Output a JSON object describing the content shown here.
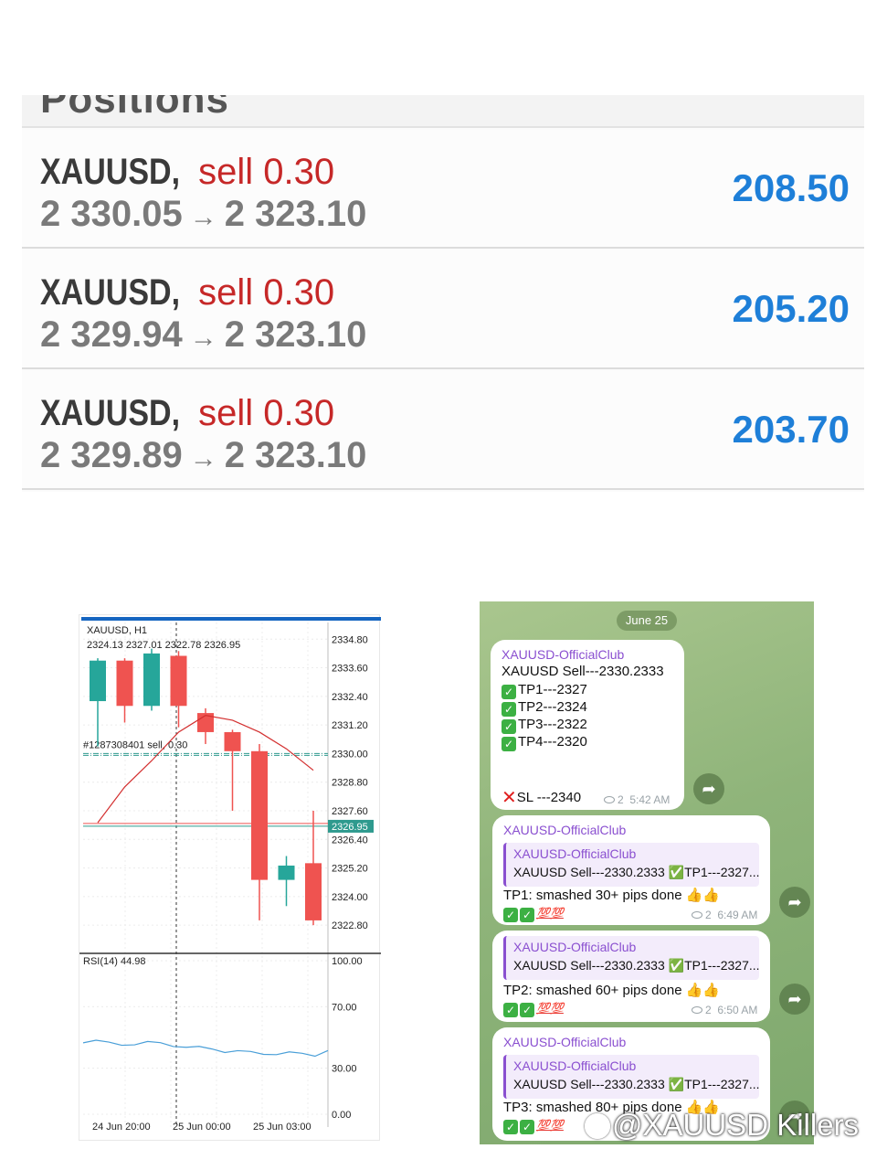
{
  "positions": {
    "header_label": "Positions",
    "rows": [
      {
        "symbol": "XAUUSD,",
        "side": "sell 0.30",
        "open_price": "2 330.05",
        "arrow": "→",
        "current_price": "2 323.10",
        "profit": "208.50"
      },
      {
        "symbol": "XAUUSD,",
        "side": "sell 0.30",
        "open_price": "2 329.94",
        "arrow": "→",
        "current_price": "2 323.10",
        "profit": "205.20"
      },
      {
        "symbol": "XAUUSD,",
        "side": "sell 0.30",
        "open_price": "2 329.89",
        "arrow": "→",
        "current_price": "2 323.10",
        "profit": "203.70"
      }
    ],
    "colors": {
      "side": "#c62828",
      "profit": "#1e7fd8",
      "symbol": "#3a3a3a"
    }
  },
  "chart_data": {
    "type": "candlestick",
    "title": "XAUUSD, H1",
    "ohlc_label": "2324.13 2327.01 2322.78 2326.95",
    "order_label": "#1287308401 sell, 0.30",
    "current_price_label": "2326.95",
    "ylim": [
      2322.0,
      2335.5
    ],
    "price_ticks": [
      "2334.80",
      "2333.60",
      "2332.40",
      "2331.20",
      "2330.00",
      "2328.80",
      "2327.60",
      "2326.40",
      "2325.20",
      "2324.00",
      "2322.80"
    ],
    "candles": [
      {
        "o": 2332.2,
        "h": 2334.0,
        "l": 2330.3,
        "c": 2333.9
      },
      {
        "o": 2333.9,
        "h": 2334.0,
        "l": 2331.3,
        "c": 2332.0
      },
      {
        "o": 2332.0,
        "h": 2334.4,
        "l": 2331.8,
        "c": 2334.2
      },
      {
        "o": 2334.1,
        "h": 2334.3,
        "l": 2331.1,
        "c": 2332.0
      },
      {
        "o": 2331.7,
        "h": 2331.9,
        "l": 2330.4,
        "c": 2330.9
      },
      {
        "o": 2330.9,
        "h": 2331.0,
        "l": 2327.6,
        "c": 2330.1
      },
      {
        "o": 2330.1,
        "h": 2330.4,
        "l": 2323.0,
        "c": 2324.7
      },
      {
        "o": 2324.7,
        "h": 2325.7,
        "l": 2323.6,
        "c": 2325.3
      },
      {
        "o": 2325.4,
        "h": 2327.6,
        "l": 2322.8,
        "c": 2323.0
      }
    ],
    "ma": [
      2327.1,
      2328.6,
      2329.7,
      2330.9,
      2331.6,
      2331.4,
      2330.9,
      2330.2,
      2329.3
    ],
    "order_price": 2330.0,
    "current_price": 2326.95,
    "rsi_label": "RSI(14) 44.98",
    "rsi_ticks": [
      "100.00",
      "70.00",
      "30.00",
      "0.00"
    ],
    "rsi_ylim": [
      0,
      100
    ],
    "rsi": [
      46.5,
      48.2,
      47.0,
      44.9,
      45.2,
      47.4,
      46.6,
      44.1,
      43.6,
      44.2,
      42.5,
      40.2,
      41.4,
      40.9,
      39.0,
      38.8,
      40.6,
      39.7,
      37.8,
      41.5
    ],
    "x_labels": [
      "24 Jun 20:00",
      "25 Jun 00:00",
      "25 Jun 03:00"
    ],
    "colors": {
      "bull": "#26a69a",
      "bear": "#ef5350",
      "ma": "#d32f2f",
      "rsi": "#4a9fd8",
      "current_line": "#2e9a8e"
    }
  },
  "telegram": {
    "date_badge": "June 25",
    "messages": [
      {
        "author": "XAUUSD-OfficialClub",
        "lines": [
          "XAUUSD Sell---2330.2333",
          "TP1---2327",
          "TP2---2324",
          "TP3---2322",
          "TP4---2320"
        ],
        "sl": "SL ---2340",
        "views": "2",
        "time": "5:42 AM"
      },
      {
        "author": "XAUUSD-OfficialClub",
        "reply_author": "XAUUSD-OfficialClub",
        "reply_text": "XAUUSD Sell---2330.2333 ✅TP1---2327...",
        "text": "TP1: smashed 30+ pips done",
        "views": "2",
        "time": "6:49 AM"
      },
      {
        "author": "XAUUSD-OfficialClub",
        "reply_author": "XAUUSD-OfficialClub",
        "reply_text": "XAUUSD Sell---2330.2333 ✅TP1---2327...",
        "text": "TP2: smashed 60+ pips done",
        "views": "2",
        "time": "6:50 AM"
      },
      {
        "author": "XAUUSD-OfficialClub",
        "reply_author": "XAUUSD-OfficialClub",
        "reply_text": "XAUUSD Sell---2330.2333 ✅TP1---2327...",
        "text": "TP3: smashed 80+ pips done"
      }
    ]
  },
  "watermark": "@XAUUSD Killers"
}
